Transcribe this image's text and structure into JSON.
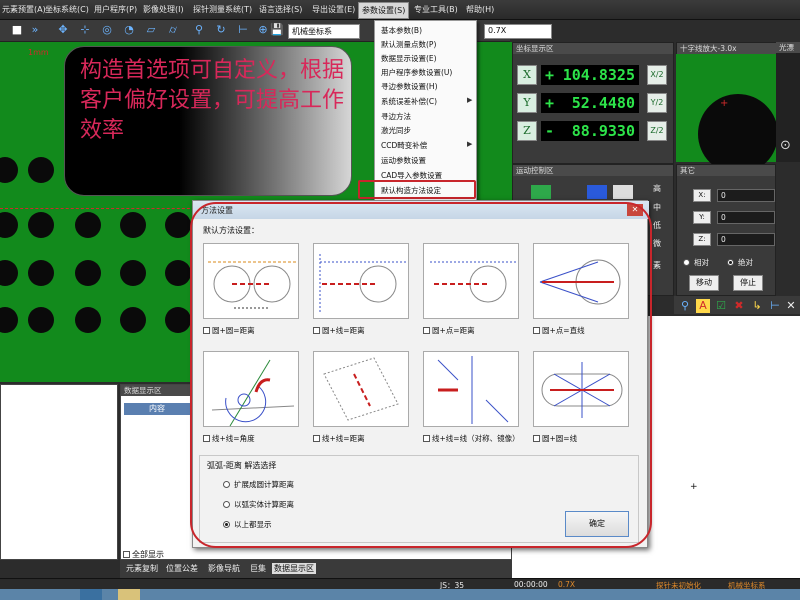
{
  "menubar": {
    "items": [
      "元素预置(A)",
      "坐标系统(C)",
      "用户程序(P)",
      "影像处理(I)",
      "探针测量系统(T)",
      "语言选择(S)",
      "导出设置(E)",
      "参数设置(S)",
      "专业工具(B)",
      "帮助(H)"
    ]
  },
  "toolbar": {
    "coord_system": "机械坐标系",
    "zoom": "0.7X"
  },
  "camera": {
    "scale_label": "1mm"
  },
  "overlay_note": {
    "text": "构造首选项可自定义，根据客户偏好设置，可提高工作效率"
  },
  "dropdown": {
    "items": [
      "基本参数(B)",
      "默认测量点数(P)",
      "数据显示设置(E)",
      "用户程序参数设置(U)",
      "寻边参数设置(H)",
      "系统误差补偿(C)",
      "寻边方法",
      "激光同步",
      "CCD畸变补偿",
      "运动参数设置",
      "CAD导入参数设置",
      "默认构造方法设定"
    ],
    "submenu_markers": [
      "系统误差补偿(C)",
      "CCD畸变补偿"
    ],
    "highlighted": "默认构造方法设定"
  },
  "axis_panel": {
    "title": "坐标显示区",
    "rows": [
      {
        "axis": "X",
        "sign": "+",
        "value": "104.8325",
        "half": "X/2"
      },
      {
        "axis": "Y",
        "sign": "+",
        "value": "52.4480",
        "half": "Y/2"
      },
      {
        "axis": "Z",
        "sign": "-",
        "value": "88.9330",
        "half": "Z/2"
      }
    ]
  },
  "cross_panel": {
    "title": "十字线放大-3.0x"
  },
  "probe_panel": {
    "title": "光漂"
  },
  "motion_panel": {
    "title": "运动控制区",
    "speeds": [
      "高",
      "中",
      "低",
      "微"
    ],
    "extra": "素"
  },
  "other_panel": {
    "title": "其它",
    "fields": [
      {
        "label": "X:",
        "value": "0"
      },
      {
        "label": "Y:",
        "value": "0"
      },
      {
        "label": "Z:",
        "value": "0"
      }
    ],
    "modes": [
      "相对",
      "绝对"
    ],
    "move_button": "移动",
    "stop_button": "停止"
  },
  "data_panel": {
    "title": "数据显示区",
    "header": "内容",
    "show_all": "全部显示"
  },
  "bottom_tabs": [
    "元素复制",
    "位置公差",
    "影像导航",
    "巨集",
    "数据显示区"
  ],
  "statusbar": {
    "js": "JS：35",
    "time": "00:00:00",
    "zoom": "0.7X",
    "probe_status": "探针未初始化",
    "coord": "机械坐标系"
  },
  "dialog": {
    "title": "方法设置",
    "section": "默认方法设置：",
    "methods": [
      "圆+圆=距离",
      "圆+线=距离",
      "圆+点=距离",
      "圆+点=直线",
      "线+线=角度",
      "线+线=距离",
      "线+线=线（对称、镜像）",
      "圆+圆=线"
    ],
    "arc_group": "弧弧-距离   解选选择",
    "options": [
      "扩展成圆计算距离",
      "以弧实体计算距离",
      "以上都显示"
    ],
    "selected_option": "以上都显示",
    "ok_button": "确定"
  }
}
